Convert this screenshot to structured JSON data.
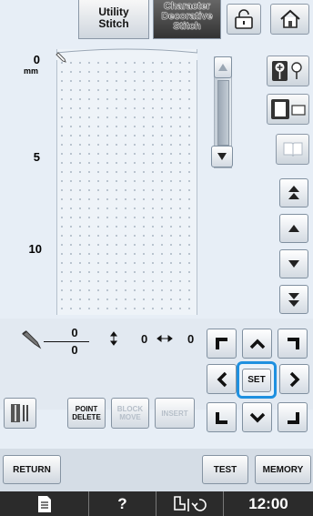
{
  "tabs": {
    "utility": [
      "Utility",
      "Stitch"
    ],
    "character": [
      "Character",
      "Decorative",
      "Stitch"
    ]
  },
  "ruler": {
    "unit": "mm",
    "marks": [
      "0",
      "5",
      "10"
    ]
  },
  "position": {
    "x_top": "0",
    "x_bottom": "0",
    "vertical": "0",
    "horizontal": "0"
  },
  "tools": {
    "point_delete": [
      "POINT",
      "DELETE"
    ],
    "block_move": [
      "BLOCK",
      "MOVE"
    ],
    "insert": "INSERT",
    "set": "SET"
  },
  "footer": {
    "return": "RETURN",
    "test": "TEST",
    "memory": "MEMORY"
  },
  "status": {
    "help": "?",
    "time": "12:00"
  },
  "icons": [
    "lock-icon",
    "home-icon",
    "needle-mode-icon",
    "frame-icon",
    "book-icon",
    "pencil-icon",
    "doc-icon",
    "presser-foot-icon"
  ],
  "colors": {
    "highlight": "#1e90e0",
    "statusbar": "#2b2b2b"
  }
}
